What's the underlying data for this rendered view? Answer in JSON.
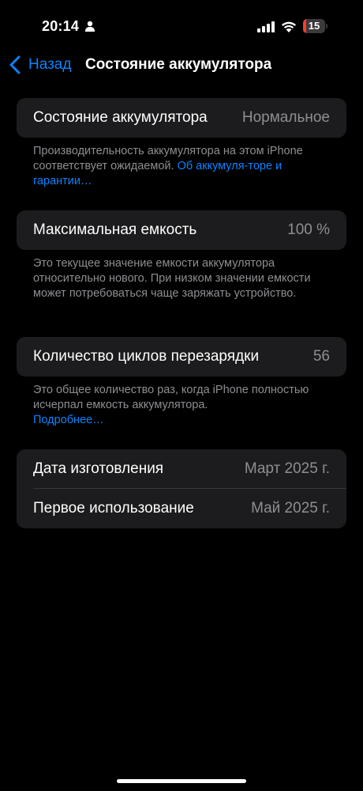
{
  "status_bar": {
    "time": "20:14",
    "battery_level": "15",
    "battery_fraction": 0.15,
    "battery_color": "#ff3b30",
    "icons": [
      "person-icon",
      "signal-icon",
      "wifi-icon",
      "battery-icon"
    ]
  },
  "nav": {
    "back_label": "Назад",
    "title": "Состояние аккумулятора"
  },
  "health": {
    "label": "Состояние аккумулятора",
    "value": "Нормальное",
    "note_text": "Производительность аккумулятора на этом iPhone соответствует ожидаемой. ",
    "note_link": "Об аккумуля-торе и гарантии…"
  },
  "capacity": {
    "label": "Максимальная емкость",
    "value": "100 %",
    "note_text": "Это текущее значение емкости аккумулятора относительно нового. При низком значении емкости может потребоваться чаще заряжать устройство."
  },
  "cycles": {
    "label": "Количество циклов перезарядки",
    "value": "56",
    "note_text": "Это общее количество раз, когда iPhone полностью исчерпал емкость аккумулятора.",
    "note_link": "Подробнее…"
  },
  "dates": {
    "manufacture_label": "Дата изготовления",
    "manufacture_value": "Март 2025 г.",
    "first_use_label": "Первое использование",
    "first_use_value": "Май 2025 г."
  },
  "colors": {
    "accent": "#0a84ff",
    "background": "#000000",
    "cell": "#1c1c1e",
    "secondary_text": "#8e8e93"
  }
}
